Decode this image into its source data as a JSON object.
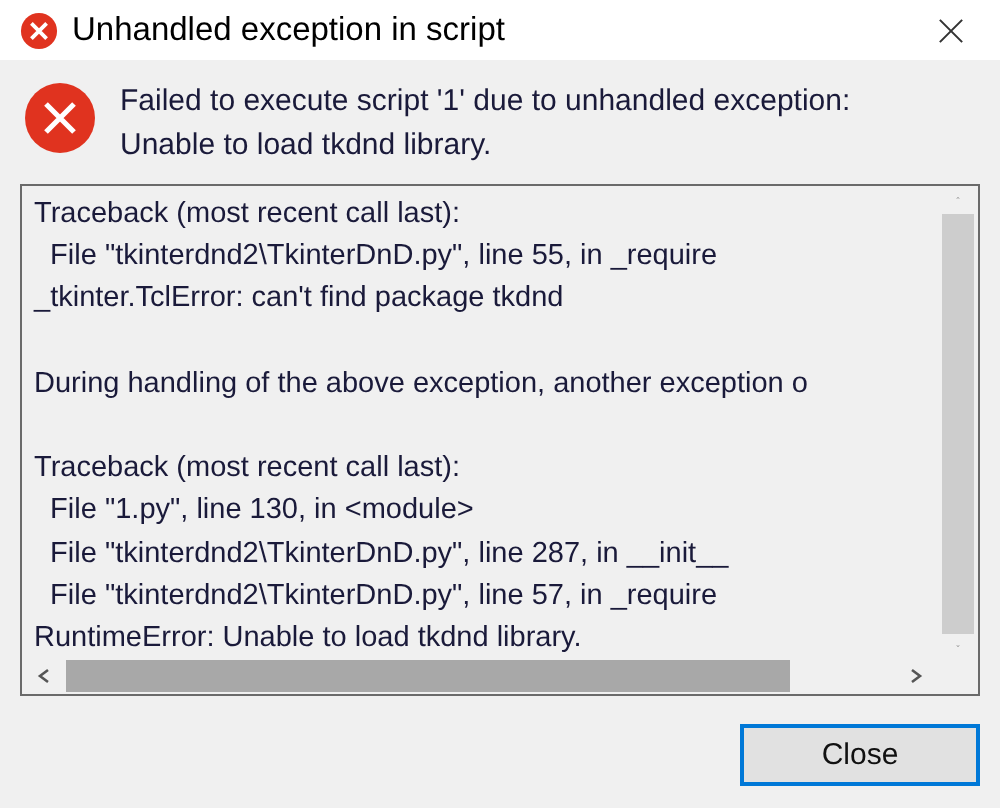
{
  "window": {
    "title": "Unhandled exception in script"
  },
  "message": {
    "lines": [
      "Failed to execute script '1' due to unhandled exception:",
      "Unable to load tkdnd library."
    ]
  },
  "traceback": {
    "blocks": [
      [
        "Traceback (most recent call last):",
        "  File \"tkinterdnd2\\TkinterDnD.py\", line 55, in _require",
        "_tkinter.TclError: can't find package tkdnd"
      ],
      [
        "During handling of the above exception, another exception o"
      ],
      [
        "Traceback (most recent call last):",
        "  File \"1.py\", line 130, in <module>",
        "  File \"tkinterdnd2\\TkinterDnD.py\", line 287, in __init__",
        "  File \"tkinterdnd2\\TkinterDnD.py\", line 57, in _require",
        "RuntimeError: Unable to load tkdnd library."
      ]
    ]
  },
  "buttons": [
    {
      "label": "Close",
      "focused": true
    }
  ]
}
